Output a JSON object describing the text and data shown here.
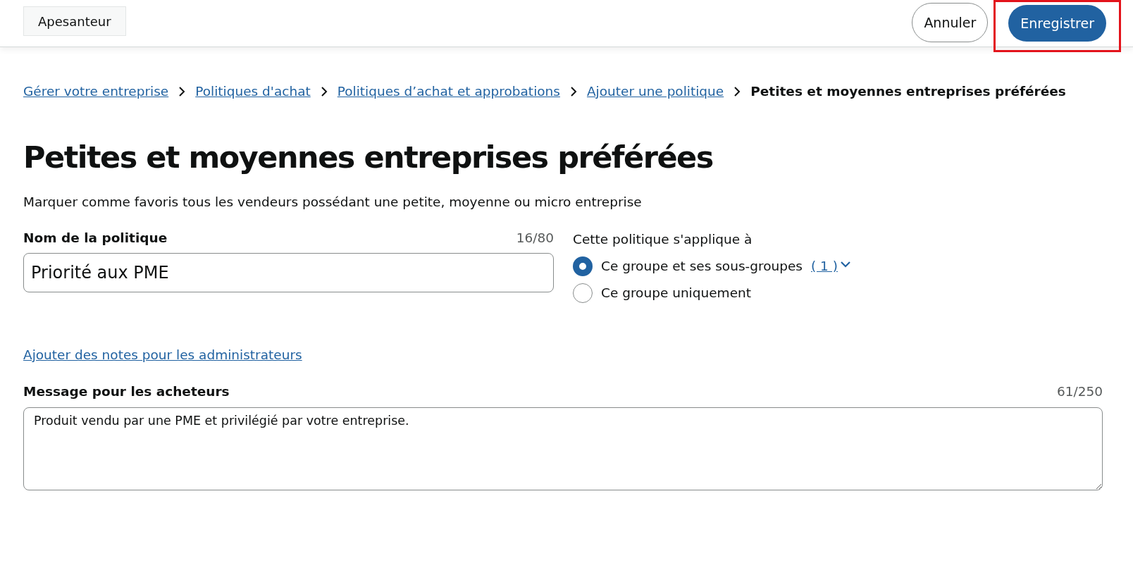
{
  "header": {
    "account": "Apesanteur",
    "cancel": "Annuler",
    "save": {
      "label": "Enregistrer",
      "highlighted": true
    }
  },
  "breadcrumb": [
    {
      "label": "Gérer votre entreprise",
      "current": false
    },
    {
      "label": "Politiques d'achat",
      "current": false
    },
    {
      "label": "Politiques d’achat et approbations",
      "current": false
    },
    {
      "label": "Ajouter une politique",
      "current": false
    },
    {
      "label": "Petites et moyennes entreprises préférées",
      "current": true
    }
  ],
  "title": "Petites et moyennes entreprises préférées",
  "description": "Marquer comme favoris tous les vendeurs possédant une petite, moyenne ou micro entreprise",
  "policy_name": {
    "label": "Nom de la politique",
    "counter": "16/80",
    "value": "Priorité aux PME"
  },
  "applies_to": {
    "label": "Cette politique s'applique à",
    "options": [
      {
        "label": "Ce groupe et ses sous-groupes",
        "count": "( 1 )",
        "selected": true
      },
      {
        "label": "Ce groupe uniquement",
        "selected": false
      }
    ]
  },
  "notes_link": "Ajouter des notes pour les administrateurs",
  "message": {
    "label": "Message pour les acheteurs",
    "counter": "61/250",
    "value": "Produit vendu par une PME et privilégié par votre entreprise."
  }
}
